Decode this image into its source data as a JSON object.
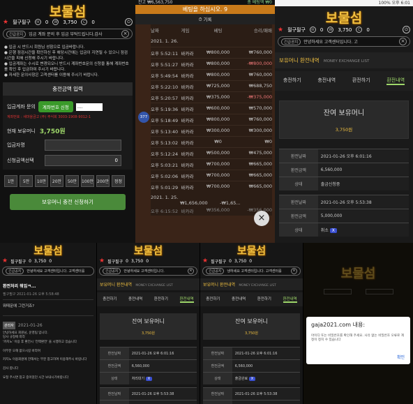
{
  "logo": "보물섬",
  "user": {
    "name": "필구필구",
    "msgs": "0",
    "points": "3,750",
    "coupons": "0"
  },
  "notice_tag": "긴급공지",
  "p1": {
    "notice": "입금 계좌 문의 후 입금 부탁드립니다.감사",
    "bullets": [
      "입금 시 반드시 회원님 성함으로 입금바랍니다.",
      "은행 점검시간을 확인하신 후 해당시간에는 입금이 지연될 수 있으니 점검시간을 피해 신청해 주시기 바랍니다.",
      "입금계좌는 수시로 변경되오니 반드시 계좌번호문의 신청을 통해 계좌번호를 확인 후 입금하여 주시기 바랍니다.",
      "자세한 문의사항은 고객센터를 이용해 주시기 바랍니다."
    ],
    "section": "충전금액 입력",
    "acct_label": "입금계좌 문의",
    "acct_btn": "계좌번호 신청",
    "acct_note": "계좌번호 : 새마을금고 (주) 주식회 3003-1908-9012-1",
    "bal_label": "현재 보유머니",
    "bal_value": "3,750원",
    "name_label": "입금자명",
    "amt_label": "신청금액선택",
    "amt_value": "0",
    "amounts": [
      "1만",
      "5만",
      "10만",
      "20만",
      "50만",
      "100만",
      "200만",
      "정정"
    ],
    "submit": "보유머니 충전 신청하기"
  },
  "p2": {
    "top": "잔고 ₩6,563,750",
    "top_right": "총 베팅액 ₩0",
    "banner": "베팅을 하십시오. 9",
    "record": "기록",
    "cols": [
      "날짜",
      "게임",
      "베팅",
      "승리/패배"
    ],
    "date1": "2021. 1. 26.",
    "rows": [
      [
        "오후 5:52:11",
        "바카라",
        "₩800,000",
        "₩760,000"
      ],
      [
        "오후 5:51:27",
        "바카라",
        "₩800,000",
        "-₩800,000"
      ],
      [
        "오후 5:49:54",
        "바카라",
        "₩800,000",
        "₩760,000"
      ],
      [
        "오후 5:22:10",
        "바카라",
        "₩725,000",
        "₩688,750"
      ],
      [
        "오후 5:20:57",
        "바카라",
        "₩375,000",
        "-₩375,000"
      ],
      [
        "오후 5:19:36",
        "바카라",
        "₩600,000",
        "₩570,000"
      ],
      [
        "오후 5:18:49",
        "바카라",
        "₩800,000",
        "₩760,000"
      ],
      [
        "오후 5:13:40",
        "바카라",
        "₩300,000",
        "₩300,000"
      ],
      [
        "오후 5:13:02",
        "바카라",
        "₩0",
        "₩0"
      ],
      [
        "오후 5:12:24",
        "바카라",
        "₩500,000",
        "₩475,000"
      ],
      [
        "오후 5:03:21",
        "바카라",
        "₩700,000",
        "₩665,000"
      ],
      [
        "오후 5:02:06",
        "바카라",
        "₩700,000",
        "₩665,000"
      ],
      [
        "오후 5:01:29",
        "바카라",
        "₩700,000",
        "₩665,000"
      ]
    ],
    "date2": "2021. 1. 25.",
    "sum_bet": "₩1,656,000",
    "sum_win": "-₩1,65...",
    "last": [
      "오후 6:15:52",
      "바카라",
      "₩356,000",
      "-₩356,000"
    ],
    "side_num": "377"
  },
  "p3": {
    "status": "100% 오후 6:01",
    "notice": "안녕하세요 고객센터입니다. 고",
    "title": "보유머니 환전내역",
    "subtitle": "MONEY EXCHANGE LIST",
    "tabs": [
      "충전하기",
      "충전내역",
      "환전하기",
      "환전내역"
    ],
    "bal_title": "잔여 보유머니",
    "bal_value": "3,750원",
    "rec1": {
      "k1": "환전날짜",
      "v1": "2021-01-26 오후 6:01:16",
      "k2": "환전금액",
      "v2": "6,560,000",
      "k3": "상태",
      "v3": "출금신청중"
    },
    "rec2": {
      "k1": "환전날짜",
      "v1": "2021-01-26 오후 5:53:38",
      "k2": "환전금액",
      "v2": "5,000,000",
      "k3": "상태",
      "v3": "취소"
    }
  },
  "p4": {
    "notice": "안녕하세요 고객센터입니다. 고객센터를",
    "subject": "환전처리 뭐임ㅋ...",
    "meta": "필구필구   2021-01-26 오후 5:58:48",
    "body": "뭐때문에 그런거죠?",
    "reply_author": "관리자",
    "reply_date": "2021-01-26",
    "reply_lines": [
      "안녕하세요 회원님, 운영팀 입니다.",
      "",
      "당사 규정에 따라",
      "'카지노' 이용 후 환전시 '전액환전' 을 시행하고 있습니다",
      "",
      "이부분 오해 없으시길 바라며",
      "",
      "카지노 이용회원에 한해서는 부분 참고하여 이용해주시 바랍니다",
      "",
      "감사 합니다",
      "",
      "요청 주시면 참고 중이었던 시간 보내시기바랍니다"
    ]
  },
  "p5": {
    "notice": "안녕하세요 고객센터입니다.",
    "title": "보유머니 환전내역",
    "subtitle": "MONEY EXCHANGE LIST",
    "tabs": [
      "충전하기",
      "충전내역",
      "환전하기",
      "환전내역"
    ],
    "bal_title": "잔여 보유머니",
    "bal_value": "3,750원",
    "rec1": {
      "k1": "환전날짜",
      "v1": "2021-01-26 오후 6:01:16",
      "k2": "환전금액",
      "v2": "6,560,000",
      "k3": "상태",
      "v3": "처리대기"
    },
    "rec2": {
      "k1": "환전날짜",
      "v1": "2021-01-26 오후 5:53:38",
      "k2": "환전금액",
      "v2": "5,000,000"
    }
  },
  "p6": {
    "notice": "냉하세요 고객센터입니다. 고객센터를",
    "title": "보유머니 환전내역",
    "subtitle": "MONEY EXCHANGE LIST",
    "tabs": [
      "충전하기",
      "충전내역",
      "환전하기",
      "환전내역"
    ],
    "bal_title": "잔여 보유머니",
    "bal_value": "3,750원",
    "rec1": {
      "k1": "환전날짜",
      "v1": "2021-01-26 오후 6:01:16",
      "k2": "환전금액",
      "v2": "6,560,000",
      "k3": "상태",
      "v3": "출금완료"
    },
    "rec2": {
      "k1": "환전날짜",
      "v1": "2021-01-26 오후 5:53:38",
      "k2": "환전금액",
      "v2": "5,000,000"
    }
  },
  "p7": {
    "bg_logo": "보물섬",
    "dialog_title": "gaja2021.com 내용:",
    "dialog_msg": "아이디 또는 비밀번호를 확인해 주세요. 사유 없는 비밀번호 오류로 계정이 정지 수 있습니다",
    "ok": "확인"
  }
}
